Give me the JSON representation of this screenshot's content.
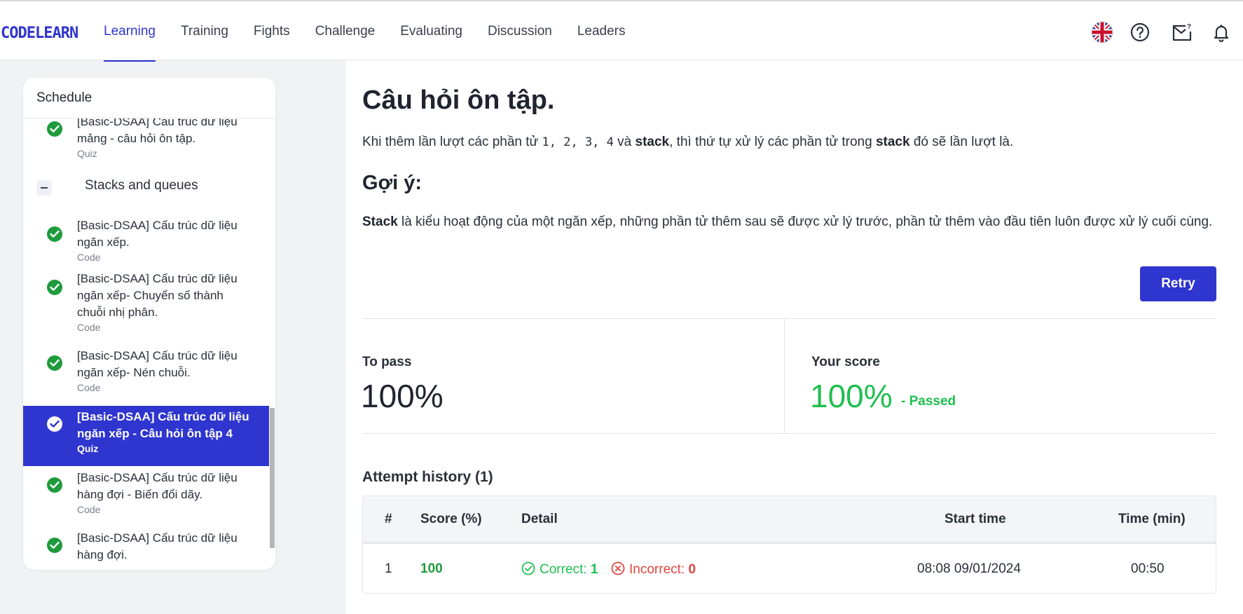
{
  "header": {
    "logo": "CODELEARN",
    "nav": [
      "Learning",
      "Training",
      "Fights",
      "Challenge",
      "Evaluating",
      "Discussion",
      "Leaders"
    ],
    "active_nav": "Learning",
    "icons": [
      "uk-flag-icon",
      "help-icon",
      "mail-icon",
      "bell-icon"
    ]
  },
  "sidebar": {
    "title": "Schedule",
    "items_before": [
      {
        "label": "[Basic-DSAA] Cấu trúc dữ liệu mảng - câu hỏi ôn tập.",
        "type": "Quiz",
        "status": "completed"
      }
    ],
    "section": "Stacks and queues",
    "items": [
      {
        "label": "[Basic-DSAA] Cấu trúc dữ liệu ngăn xếp.",
        "type": "Code",
        "status": "completed"
      },
      {
        "label": "[Basic-DSAA] Cấu trúc dữ liệu ngăn xếp- Chuyển số thành chuỗi nhị phân.",
        "type": "Code",
        "status": "completed"
      },
      {
        "label": "[Basic-DSAA] Cấu trúc dữ liệu ngăn xếp- Nén chuỗi.",
        "type": "Code",
        "status": "completed"
      },
      {
        "label": "[Basic-DSAA] Cấu trúc dữ liệu ngăn xếp - Câu hỏi ôn tập 4",
        "type": "Quiz",
        "status": "completed",
        "active": true
      },
      {
        "label": "[Basic-DSAA] Cấu trúc dữ liệu hàng đợi - Biến đổi dãy.",
        "type": "Code",
        "status": "completed"
      },
      {
        "label": "[Basic-DSAA] Cấu trúc dữ liệu hàng đợi.",
        "type": "",
        "status": "completed"
      }
    ]
  },
  "main": {
    "title": "Câu hỏi ôn tập.",
    "question": {
      "part1": "Khi thêm lần lượt các phần tử ",
      "sequence": "1, 2, 3, 4",
      "part2": " và ",
      "keyword1": "stack",
      "part3": ", thì thứ tự xử lý các phần tử trong ",
      "keyword2": "stack",
      "part4": " đó sẽ lần lượt là."
    },
    "hint_title": "Gợi ý:",
    "hint": {
      "keyword": "Stack",
      "text": " là kiểu hoạt động của một ngăn xếp, những phần tử thêm sau sẽ được xử lý trước, phần tử thêm vào đầu tiên luôn được xử lý cuối cùng."
    },
    "retry_label": "Retry",
    "to_pass_label": "To pass",
    "to_pass_value": "100%",
    "your_score_label": "Your score",
    "your_score_value": "100%",
    "score_status": "- Passed",
    "history_title": "Attempt history (1)",
    "history_columns": [
      "#",
      "Score (%)",
      "Detail",
      "Start time",
      "Time (min)"
    ],
    "history_rows": [
      {
        "index": "1",
        "score": "100",
        "correct_label": "Correct:",
        "correct": "1",
        "incorrect_label": "Incorrect:",
        "incorrect": "0",
        "start_time": "08:08 09/01/2024",
        "time": "00:50"
      }
    ]
  },
  "colors": {
    "accent": "#2f35cf",
    "success": "#1fbf4f",
    "completed_check": "#1e9b3c",
    "error": "#e2453f"
  }
}
